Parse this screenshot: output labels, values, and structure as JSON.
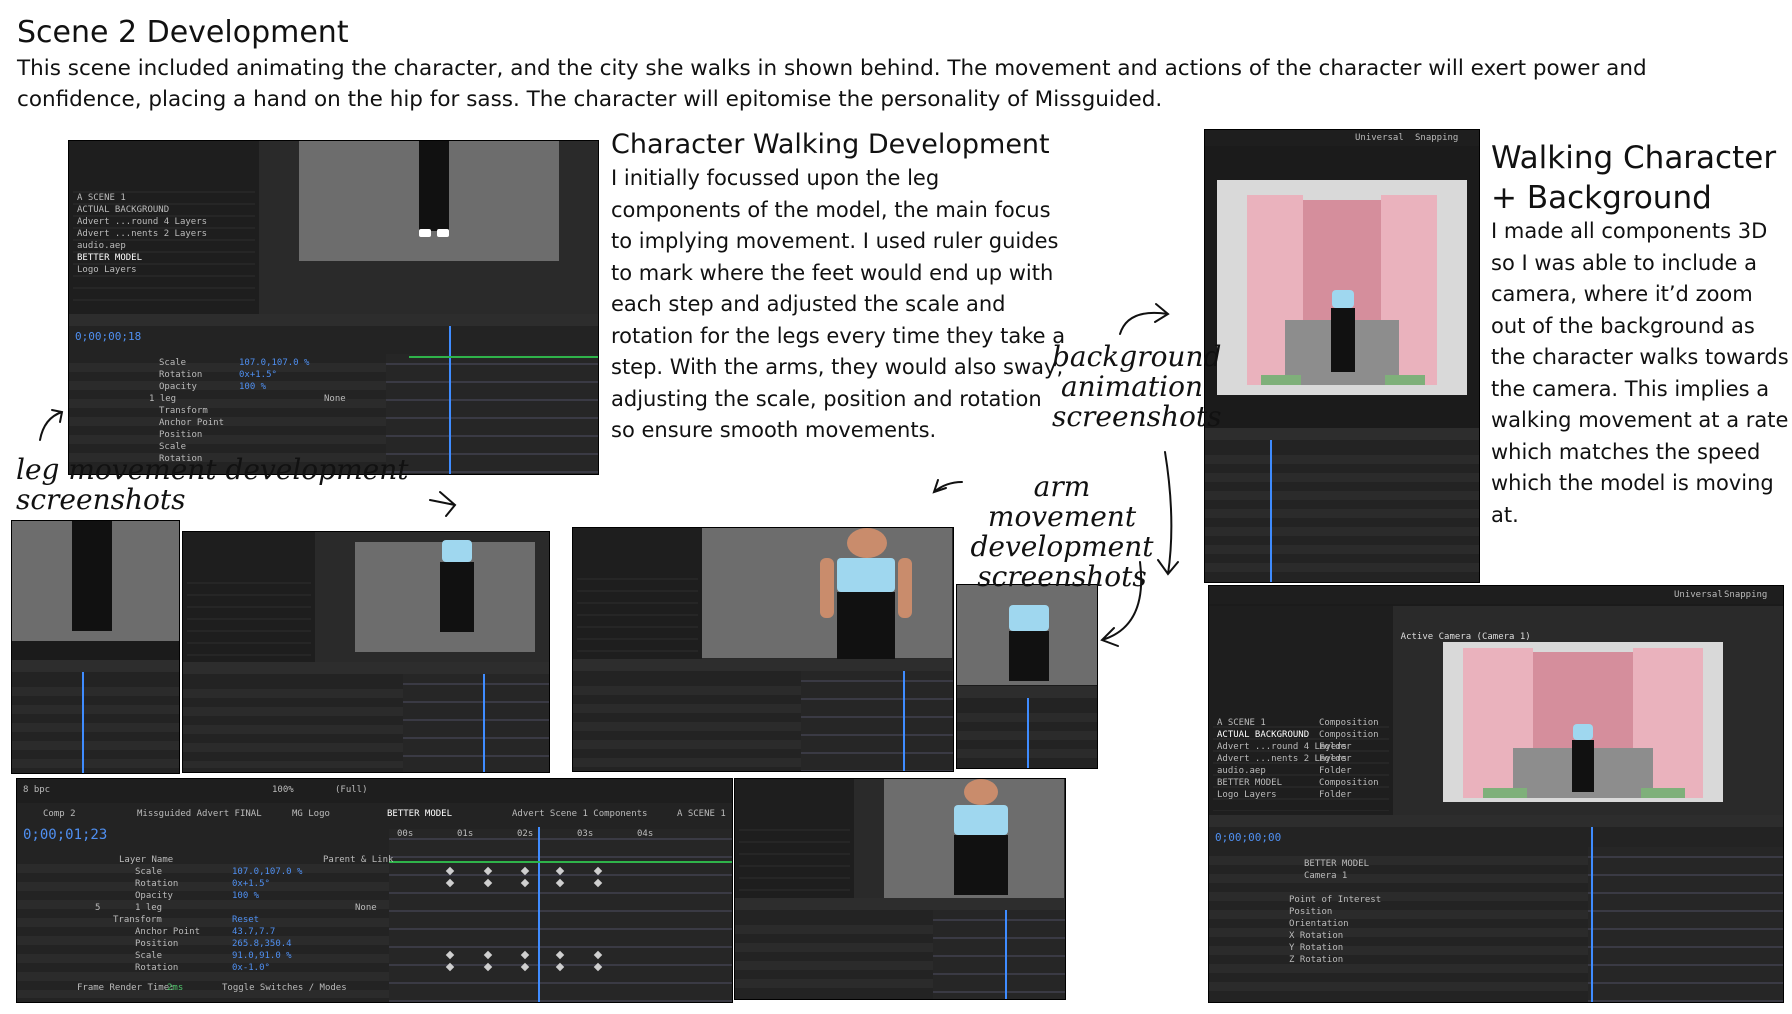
{
  "title": "Scene 2 Development",
  "intro": "This scene included animating the character, and the city she walks in shown behind. The movement and actions of the character will exert power and confidence, placing a hand on the hip for sass. The character will epitomise the personality of Missguided.",
  "walking": {
    "heading": "Character Walking Development",
    "body": "I initially focussed upon the leg components of the model, the main focus to implying movement. I used ruler guides to mark where the feet would end up with each step and adjusted the scale and rotation for the legs every time they take a step. With the arms, they would also sway, adjusting the scale, position and rotation so ensure smooth movements."
  },
  "background": {
    "heading": "Walking Character + Background",
    "body": "I made all components 3D so I was able to include a camera, where it’d zoom out of the background as the character walks towards the camera. This implies a walking movement at a rate which matches the speed which the model is moving at."
  },
  "notes": {
    "leg": "leg movement development screenshots",
    "background": "background animation screenshots",
    "arm": "arm movement development screenshots"
  },
  "ae": {
    "big_timecode": "0;00;01;23",
    "small_timecode": "0;00;00;18",
    "bg_timecode": "0;00;00;00",
    "tabs": [
      "Comp 2",
      "Missguided Advert FINAL",
      "MG Logo",
      "BETTER MODEL",
      "Advert Scene 1 Components",
      "A SCENE 1"
    ],
    "zoom": "100%",
    "quality": "(Full)",
    "bpc": "8 bpc",
    "header_layer": "Layer Name",
    "header_parent": "Parent & Link",
    "props": [
      "Scale",
      "Rotation",
      "Opacity",
      "1 leg",
      "Transform",
      "Anchor Point",
      "Position",
      "Scale",
      "Rotation"
    ],
    "values": [
      "107.0,107.0 %",
      "0x+1.5°",
      "100 %",
      "Reset",
      "43.7,7.7",
      "265.8,350.4",
      "91.0,91.0 %",
      "0x-1.0°"
    ],
    "layer_num": "5",
    "parent_none": "None",
    "ruler": [
      "00s",
      "01s",
      "02s",
      "03s",
      "04s"
    ],
    "frame_render": "Frame Render Time:",
    "frame_render_val": "2ms",
    "toggle": "Toggle Switches / Modes",
    "project_items": [
      "A SCENE 1",
      "ACTUAL BACKGROUND",
      "Advert ...round 4 Layers",
      "Advert ...nents 2 Layers",
      "audio.aep",
      "BETTER MODEL",
      "Logo Layers"
    ],
    "project_types": [
      "Composition",
      "Composition",
      "Folder",
      "Folder",
      "Folder",
      "Composition",
      "Folder"
    ],
    "bg_layers": [
      "BETTER MODEL",
      "Camera 1"
    ],
    "bg_props": [
      "Point of Interest",
      "Position",
      "Orientation",
      "X Rotation",
      "Y Rotation",
      "Z Rotation"
    ],
    "active_camera": "Active Camera (Camera 1)",
    "universal": "Universal",
    "snapping": "Snapping"
  }
}
